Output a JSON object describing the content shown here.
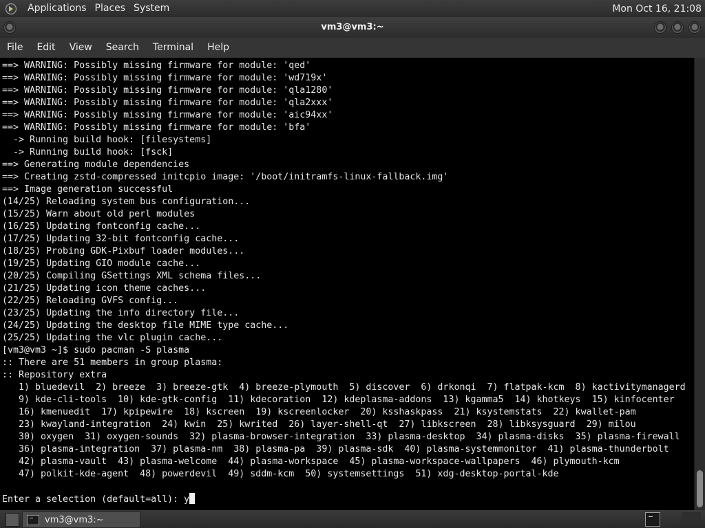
{
  "top_panel": {
    "menus": [
      "Applications",
      "Places",
      "System"
    ],
    "clock": "Mon Oct 16, 21:08",
    "logo_icon": "gnome-foot-icon"
  },
  "window": {
    "title": "vm3@vm3:~"
  },
  "menubar": {
    "items": [
      "File",
      "Edit",
      "View",
      "Search",
      "Terminal",
      "Help"
    ]
  },
  "terminal": {
    "lines": [
      "==> WARNING: Possibly missing firmware for module: 'qed'",
      "==> WARNING: Possibly missing firmware for module: 'wd719x'",
      "==> WARNING: Possibly missing firmware for module: 'qla1280'",
      "==> WARNING: Possibly missing firmware for module: 'qla2xxx'",
      "==> WARNING: Possibly missing firmware for module: 'aic94xx'",
      "==> WARNING: Possibly missing firmware for module: 'bfa'",
      "  -> Running build hook: [filesystems]",
      "  -> Running build hook: [fsck]",
      "==> Generating module dependencies",
      "==> Creating zstd-compressed initcpio image: '/boot/initramfs-linux-fallback.img'",
      "==> Image generation successful",
      "(14/25) Reloading system bus configuration...",
      "(15/25) Warn about old perl modules",
      "(16/25) Updating fontconfig cache...",
      "(17/25) Updating 32-bit fontconfig cache...",
      "(18/25) Probing GDK-Pixbuf loader modules...",
      "(19/25) Updating GIO module cache...",
      "(20/25) Compiling GSettings XML schema files...",
      "(21/25) Updating icon theme caches...",
      "(22/25) Reloading GVFS config...",
      "(23/25) Updating the info directory file...",
      "(24/25) Updating the desktop file MIME type cache...",
      "(25/25) Updating the vlc plugin cache...",
      "[vm3@vm3 ~]$ sudo pacman -S plasma",
      ":: There are 51 members in group plasma:",
      ":: Repository extra",
      "   1) bluedevil  2) breeze  3) breeze-gtk  4) breeze-plymouth  5) discover  6) drkonqi  7) flatpak-kcm  8) kactivitymanagerd",
      "   9) kde-cli-tools  10) kde-gtk-config  11) kdecoration  12) kdeplasma-addons  13) kgamma5  14) khotkeys  15) kinfocenter",
      "   16) kmenuedit  17) kpipewire  18) kscreen  19) kscreenlocker  20) ksshaskpass  21) ksystemstats  22) kwallet-pam",
      "   23) kwayland-integration  24) kwin  25) kwrited  26) layer-shell-qt  27) libkscreen  28) libksysguard  29) milou",
      "   30) oxygen  31) oxygen-sounds  32) plasma-browser-integration  33) plasma-desktop  34) plasma-disks  35) plasma-firewall",
      "   36) plasma-integration  37) plasma-nm  38) plasma-pa  39) plasma-sdk  40) plasma-systemmonitor  41) plasma-thunderbolt",
      "   42) plasma-vault  43) plasma-welcome  44) plasma-workspace  45) plasma-workspace-wallpapers  46) plymouth-kcm",
      "   47) polkit-kde-agent  48) powerdevil  49) sddm-kcm  50) systemsettings  51) xdg-desktop-portal-kde",
      ""
    ],
    "prompt_line": "Enter a selection (default=all): y"
  },
  "taskbar": {
    "task_label": "vm3@vm3:~"
  },
  "colors": {
    "terminal_bg": "#000000",
    "terminal_fg": "#e6e6e6",
    "panel_bg": "#2f2f2f"
  }
}
